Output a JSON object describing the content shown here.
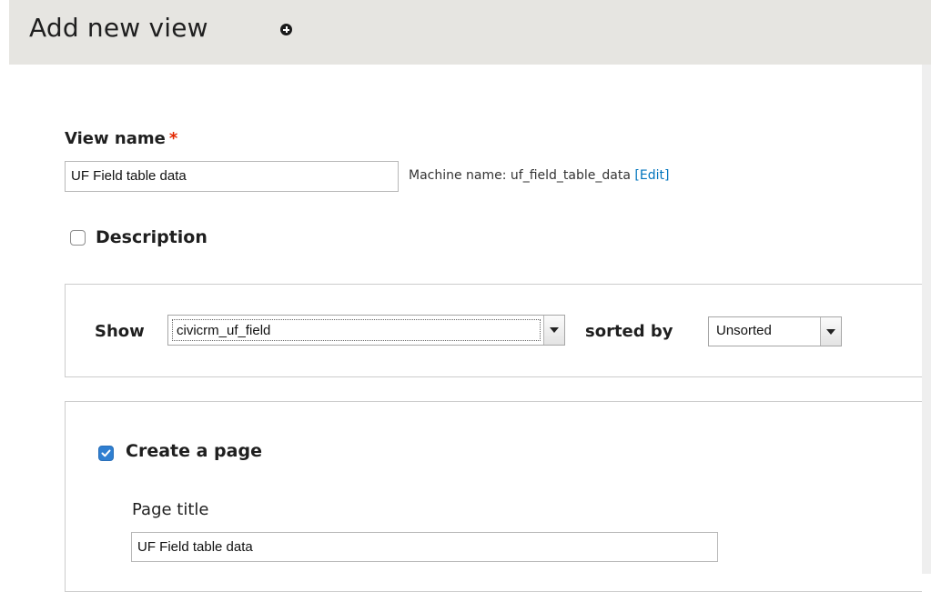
{
  "header": {
    "title": "Add new view",
    "add_icon": "plus-circle-icon"
  },
  "view_name": {
    "label": "View name",
    "required_mark": "*",
    "value": "UF Field table data",
    "machine_name_prefix": "Machine name: uf_field_table_data",
    "machine_name_edit": "[Edit]"
  },
  "description": {
    "label": "Description",
    "checked": false
  },
  "show_panel": {
    "show_label": "Show",
    "show_value": "civicrm_uf_field",
    "sorted_label": "sorted by",
    "sorted_value": "Unsorted"
  },
  "page_panel": {
    "create_page_label": "Create a page",
    "create_page_checked": true,
    "page_title_label": "Page title",
    "page_title_value": "UF Field table data"
  },
  "colors": {
    "header_bg": "#e6e5e1",
    "required": "#e32700",
    "link": "#0074bd",
    "checkbox_checked": "#2f7fd1"
  }
}
